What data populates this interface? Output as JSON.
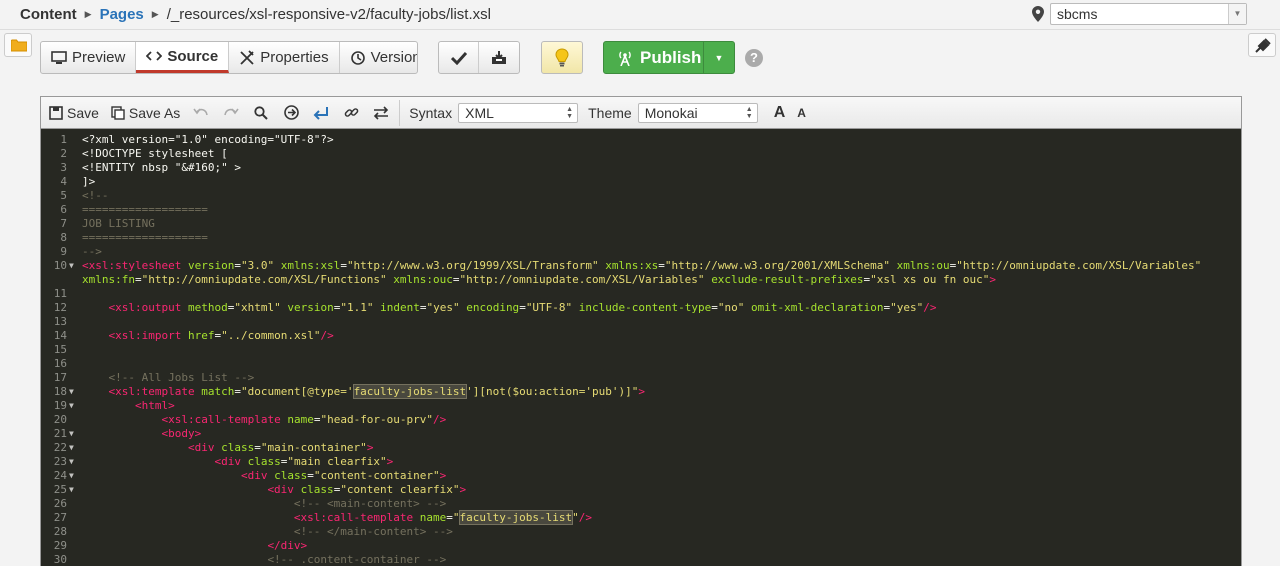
{
  "breadcrumb": {
    "root": "Content",
    "pages": "Pages",
    "path": "/_resources/xsl-responsive-v2/faculty-jobs/list.xsl"
  },
  "site_selector": {
    "value": "sbcms"
  },
  "view_tabs": [
    {
      "label": "Preview",
      "icon": "monitor-icon",
      "active": false
    },
    {
      "label": "Source",
      "icon": "code-icon",
      "active": true
    },
    {
      "label": "Properties",
      "icon": "tools-icon",
      "active": false
    },
    {
      "label": "Versions",
      "icon": "history-icon",
      "active": false
    }
  ],
  "publish": {
    "label": "Publish"
  },
  "help": {
    "glyph": "?"
  },
  "editor_toolbar": {
    "save": "Save",
    "save_as": "Save As",
    "syntax_label": "Syntax",
    "syntax_value": "XML",
    "theme_label": "Theme",
    "theme_value": "Monokai",
    "font_increase": "A",
    "font_decrease": "A"
  },
  "colors": {
    "publish_green": "#4cae4c",
    "active_tab_accent": "#c0392b",
    "editor_bg": "#272822",
    "tag": "#f92672",
    "attr": "#a6e22e",
    "string": "#e6db74",
    "comment": "#75715e"
  },
  "code_lines": [
    {
      "n": "1",
      "fold": false,
      "html": "&lt;?xml version=\"1.0\" encoding=\"UTF-8\"?&gt;"
    },
    {
      "n": "2",
      "fold": false,
      "html": "&lt;!DOCTYPE stylesheet ["
    },
    {
      "n": "3",
      "fold": false,
      "html": "&lt;!ENTITY nbsp \"&amp;#160;\" &gt;"
    },
    {
      "n": "4",
      "fold": false,
      "html": "]&gt;"
    },
    {
      "n": "5",
      "fold": false,
      "html": "<span class='c'>&lt;!--</span>"
    },
    {
      "n": "6",
      "fold": false,
      "html": "<span class='c'>===================</span>"
    },
    {
      "n": "7",
      "fold": false,
      "html": "<span class='c'>JOB LISTING</span>"
    },
    {
      "n": "8",
      "fold": false,
      "html": "<span class='c'>===================</span>"
    },
    {
      "n": "9",
      "fold": false,
      "html": "<span class='c'>--&gt;</span>"
    },
    {
      "n": "10",
      "fold": true,
      "html": "<span class='t'>&lt;xsl:stylesheet</span> <span class='a'>version</span>=<span class='s'>\"3.0\"</span> <span class='a'>xmlns:xsl</span>=<span class='s'>\"http://www.w3.org/1999/XSL/Transform\"</span> <span class='a'>xmlns:xs</span>=<span class='s'>\"http://www.w3.org/2001/XMLSchema\"</span> <span class='a'>xmlns:ou</span>=<span class='s'>\"http://omniupdate.com/XSL/Variables\"</span>"
    },
    {
      "n": "",
      "fold": false,
      "html": "<span class='a'>xmlns:fn</span>=<span class='s'>\"http://omniupdate.com/XSL/Functions\"</span> <span class='a'>xmlns:ouc</span>=<span class='s'>\"http://omniupdate.com/XSL/Variables\"</span> <span class='a'>exclude-result-prefixes</span>=<span class='s'>\"xsl xs ou fn ouc\"</span><span class='t'>&gt;</span>"
    },
    {
      "n": "11",
      "fold": false,
      "html": ""
    },
    {
      "n": "12",
      "fold": false,
      "html": "    <span class='t'>&lt;xsl:output</span> <span class='a'>method</span>=<span class='s'>\"xhtml\"</span> <span class='a'>version</span>=<span class='s'>\"1.1\"</span> <span class='a'>indent</span>=<span class='s'>\"yes\"</span> <span class='a'>encoding</span>=<span class='s'>\"UTF-8\"</span> <span class='a'>include-content-type</span>=<span class='s'>\"no\"</span> <span class='a'>omit-xml-declaration</span>=<span class='s'>\"yes\"</span><span class='t'>/&gt;</span>"
    },
    {
      "n": "13",
      "fold": false,
      "html": ""
    },
    {
      "n": "14",
      "fold": false,
      "html": "    <span class='t'>&lt;xsl:import</span> <span class='a'>href</span>=<span class='s'>\"../common.xsl\"</span><span class='t'>/&gt;</span>"
    },
    {
      "n": "15",
      "fold": false,
      "html": ""
    },
    {
      "n": "16",
      "fold": false,
      "html": ""
    },
    {
      "n": "17",
      "fold": false,
      "html": "    <span class='c'>&lt;!-- All Jobs List --&gt;</span>"
    },
    {
      "n": "18",
      "fold": true,
      "html": "    <span class='t'>&lt;xsl:template</span> <span class='a'>match</span>=<span class='s'>\"document[@type='<span class='hl'>faculty-jobs-list</span>'][not($ou:action='pub')]\"</span><span class='t'>&gt;</span>"
    },
    {
      "n": "19",
      "fold": true,
      "html": "        <span class='t'>&lt;html&gt;</span>"
    },
    {
      "n": "20",
      "fold": false,
      "html": "            <span class='t'>&lt;xsl:call-template</span> <span class='a'>name</span>=<span class='s'>\"head-for-ou-prv\"</span><span class='t'>/&gt;</span>"
    },
    {
      "n": "21",
      "fold": true,
      "html": "            <span class='t'>&lt;body&gt;</span>"
    },
    {
      "n": "22",
      "fold": true,
      "html": "                <span class='t'>&lt;div</span> <span class='a'>class</span>=<span class='s'>\"main-container\"</span><span class='t'>&gt;</span>"
    },
    {
      "n": "23",
      "fold": true,
      "html": "                    <span class='t'>&lt;div</span> <span class='a'>class</span>=<span class='s'>\"main clearfix\"</span><span class='t'>&gt;</span>"
    },
    {
      "n": "24",
      "fold": true,
      "html": "                        <span class='t'>&lt;div</span> <span class='a'>class</span>=<span class='s'>\"content-container\"</span><span class='t'>&gt;</span>"
    },
    {
      "n": "25",
      "fold": true,
      "html": "                            <span class='t'>&lt;div</span> <span class='a'>class</span>=<span class='s'>\"content clearfix\"</span><span class='t'>&gt;</span>"
    },
    {
      "n": "26",
      "fold": false,
      "html": "                                <span class='c'>&lt;!-- &lt;main-content&gt; --&gt;</span>"
    },
    {
      "n": "27",
      "fold": false,
      "html": "                                <span class='t'>&lt;xsl:call-template</span> <span class='a'>name</span>=<span class='s'>\"<span class='hl'>faculty-jobs-list</span>\"</span><span class='t'>/&gt;</span>"
    },
    {
      "n": "28",
      "fold": false,
      "html": "                                <span class='c'>&lt;!-- &lt;/main-content&gt; --&gt;</span>"
    },
    {
      "n": "29",
      "fold": false,
      "html": "                            <span class='t'>&lt;/div&gt;</span>"
    },
    {
      "n": "30",
      "fold": false,
      "html": "                            <span class='c'>&lt;!-- .content-container --&gt;</span>"
    }
  ]
}
